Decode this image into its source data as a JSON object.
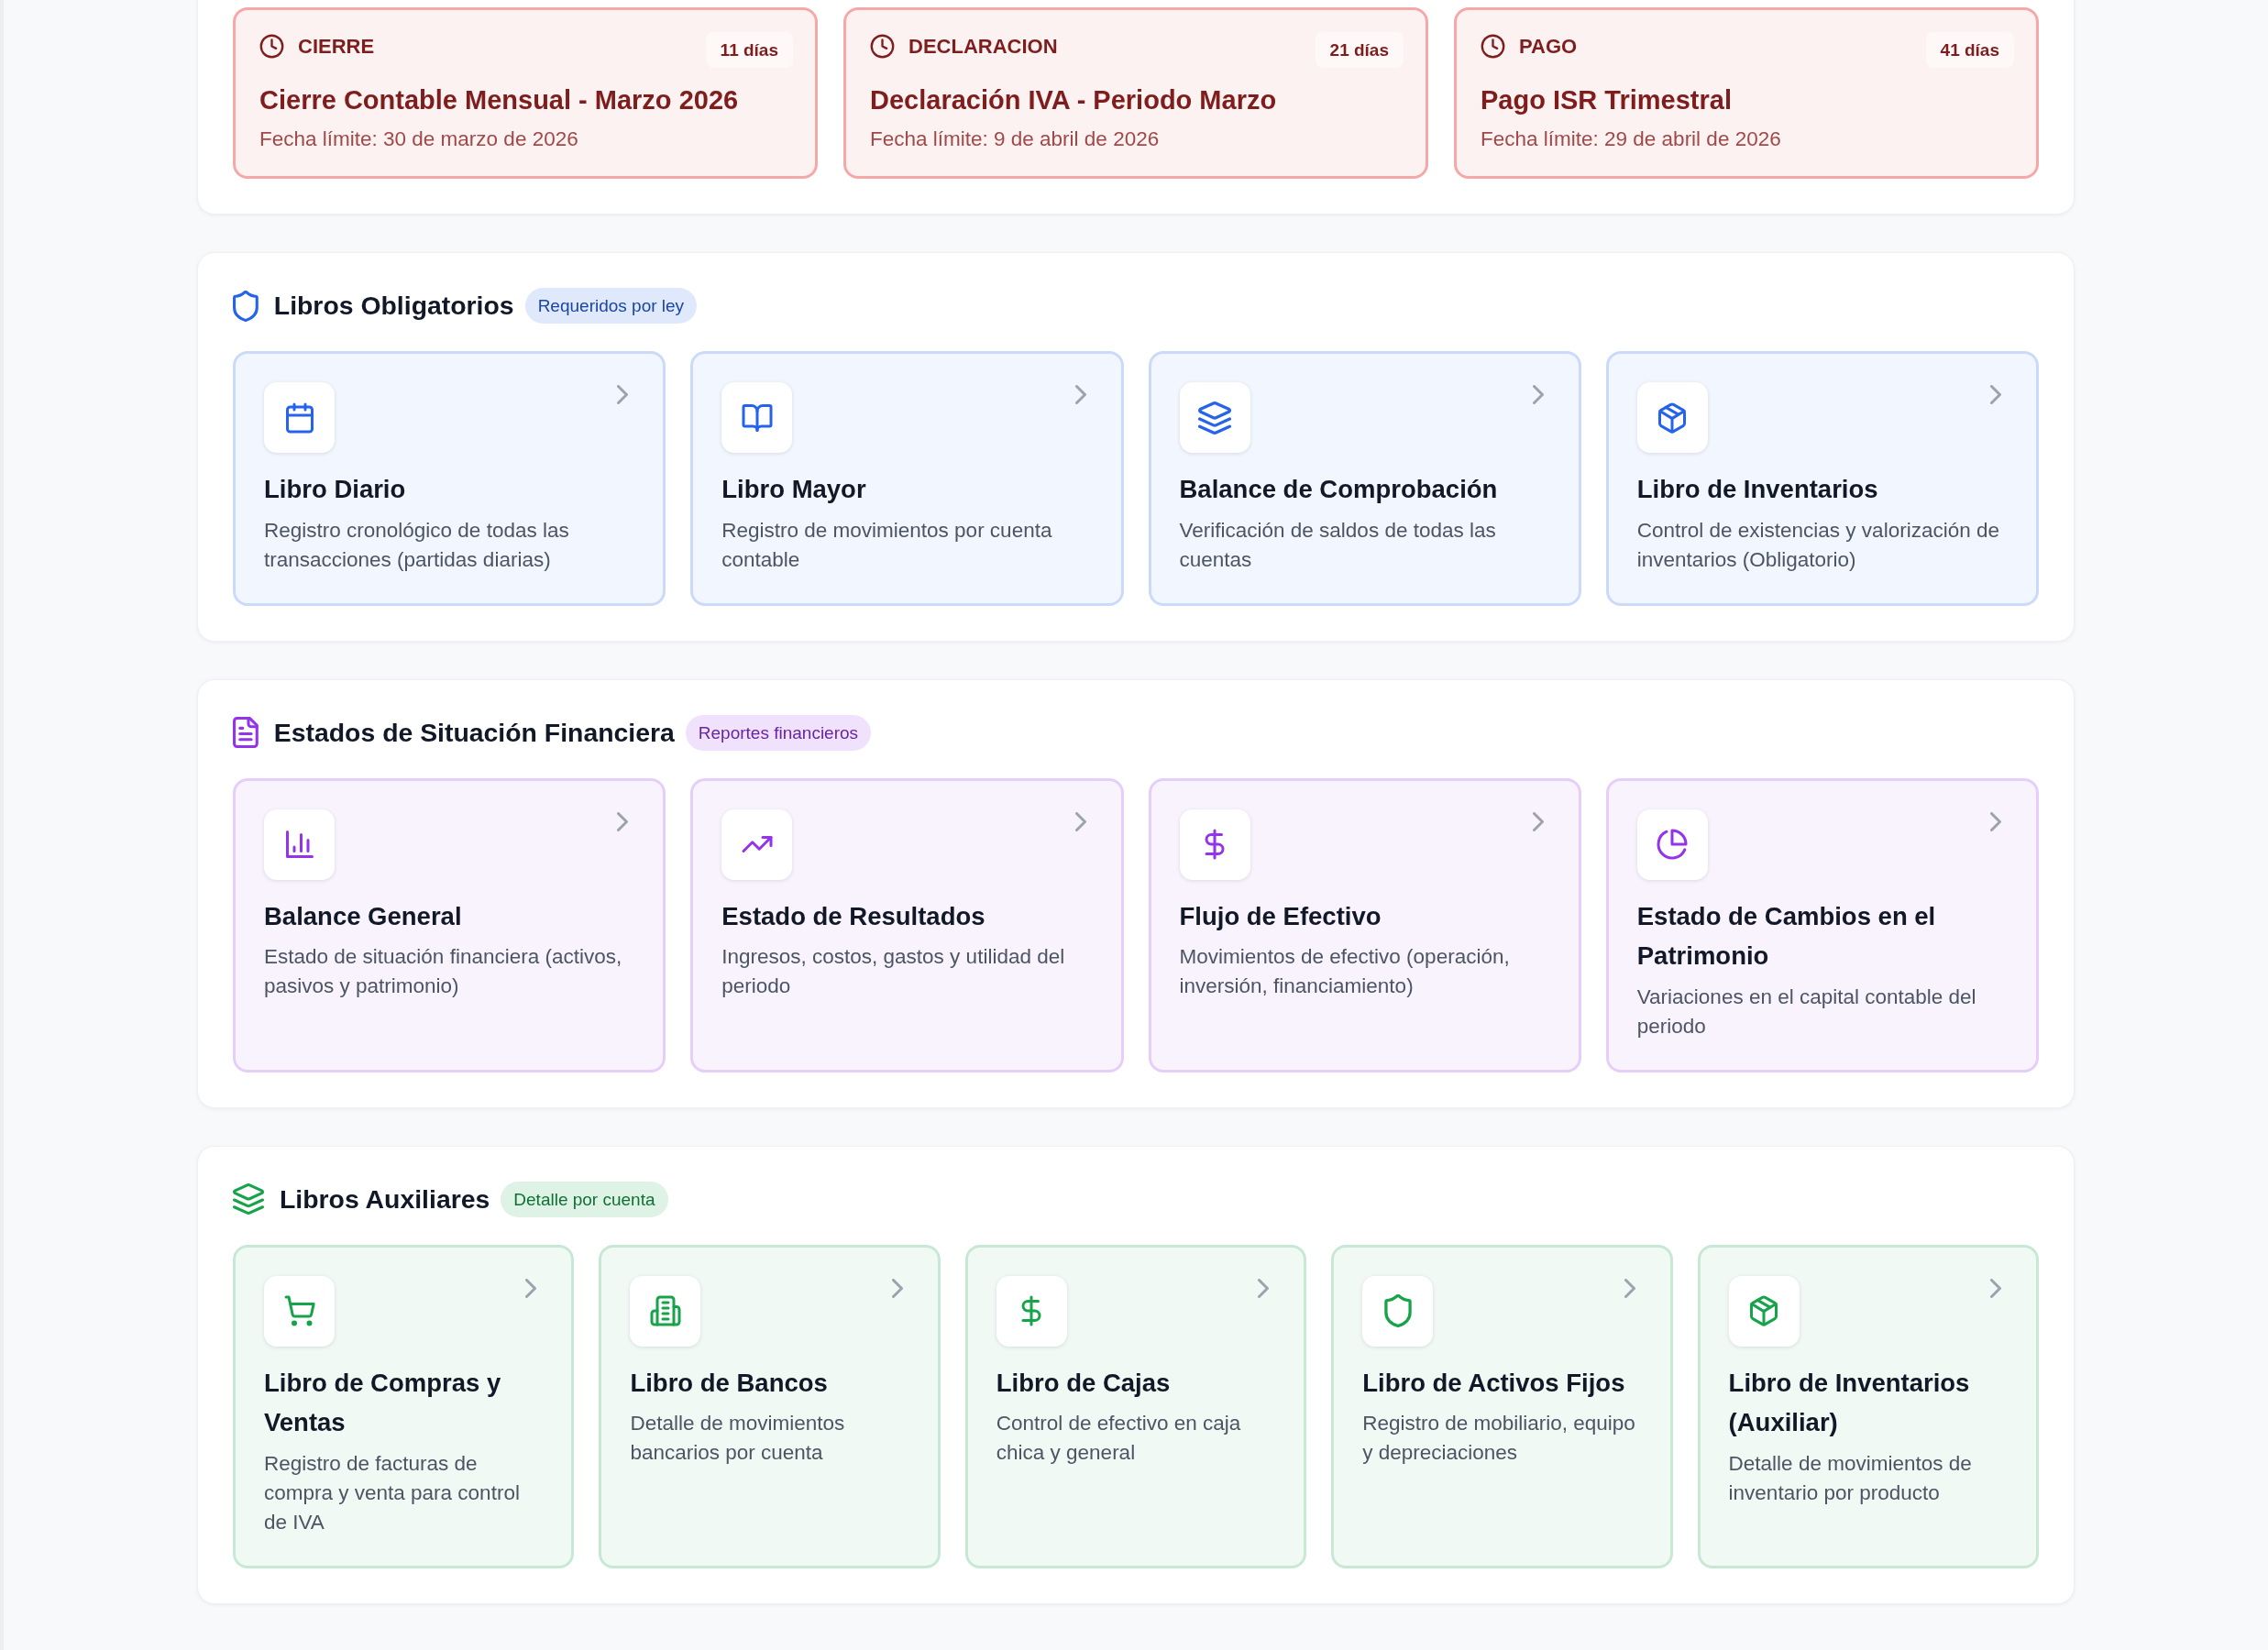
{
  "deadlines": [
    {
      "category": "CIERRE",
      "days_left": "11 días",
      "title": "Cierre Contable Mensual - Marzo 2026",
      "due": "Fecha límite: 30 de marzo de 2026"
    },
    {
      "category": "DECLARACION",
      "days_left": "21 días",
      "title": "Declaración IVA - Periodo Marzo",
      "due": "Fecha límite: 9 de abril de 2026"
    },
    {
      "category": "PAGO",
      "days_left": "41 días",
      "title": "Pago ISR Trimestral",
      "due": "Fecha límite: 29 de abril de 2026"
    }
  ],
  "sections": [
    {
      "title": "Libros Obligatorios",
      "badge": "Requeridos por ley",
      "color": "#2563eb",
      "cards": [
        {
          "title": "Libro Diario",
          "description": "Registro cronológico de todas las transacciones (partidas diarias)"
        },
        {
          "title": "Libro Mayor",
          "description": "Registro de movimientos por cuenta contable"
        },
        {
          "title": "Balance de Comprobación",
          "description": "Verificación de saldos de todas las cuentas"
        },
        {
          "title": "Libro de Inventarios",
          "description": "Control de existencias y valorización de inventarios (Obligatorio)"
        }
      ]
    },
    {
      "title": "Estados de Situación Financiera",
      "badge": "Reportes financieros",
      "color": "#9333ea",
      "cards": [
        {
          "title": "Balance General",
          "description": "Estado de situación financiera (activos, pasivos y patrimonio)"
        },
        {
          "title": "Estado de Resultados",
          "description": "Ingresos, costos, gastos y utilidad del periodo"
        },
        {
          "title": "Flujo de Efectivo",
          "description": "Movimientos de efectivo (operación, inversión, financiamiento)"
        },
        {
          "title": "Estado de Cambios en el Patrimonio",
          "description": "Variaciones en el capital contable del periodo"
        }
      ]
    },
    {
      "title": "Libros Auxiliares",
      "badge": "Detalle por cuenta",
      "color": "#16a34a",
      "cards": [
        {
          "title": "Libro de Compras y Ventas",
          "description": "Registro de facturas de compra y venta para control de IVA"
        },
        {
          "title": "Libro de Bancos",
          "description": "Detalle de movimientos bancarios por cuenta"
        },
        {
          "title": "Libro de Cajas",
          "description": "Control de efectivo en caja chica y general"
        },
        {
          "title": "Libro de Activos Fijos",
          "description": "Registro de mobiliario, equipo y depreciaciones"
        },
        {
          "title": "Libro de Inventarios (Auxiliar)",
          "description": "Detalle de movimientos de inventario por producto"
        }
      ]
    }
  ]
}
